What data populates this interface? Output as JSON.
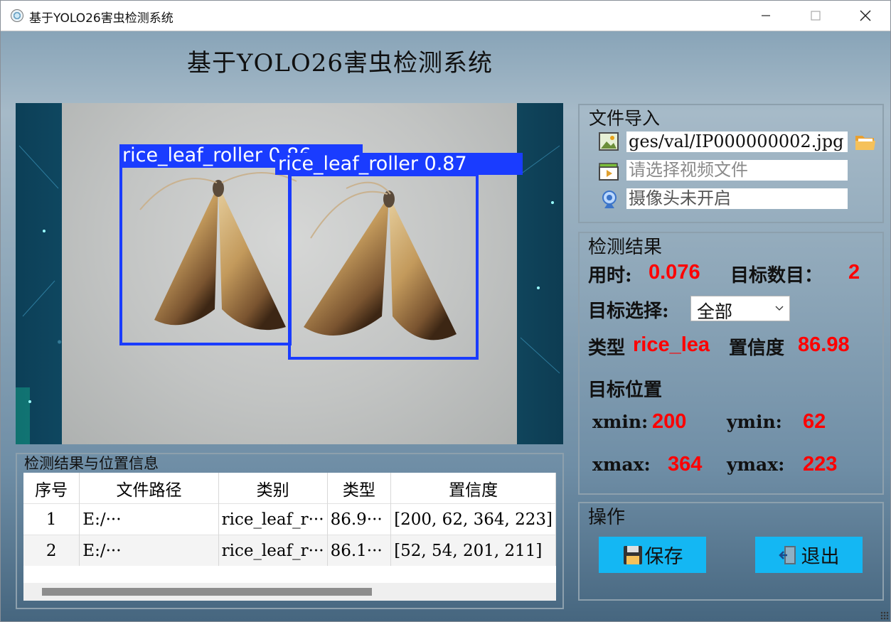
{
  "window": {
    "title": "基于YOLO26害虫检测系统"
  },
  "heading": "基于YOLO26害虫检测系统",
  "detections": [
    {
      "label": "rice_leaf_roller 0.86"
    },
    {
      "label": "rice_leaf_roller 0.87"
    }
  ],
  "file_import": {
    "title": "文件导入",
    "image_path": "ges/val/IP000000002.jpg",
    "video_placeholder": "请选择视频文件",
    "camera_status": "摄像头未开启"
  },
  "results": {
    "title": "检测结果",
    "time_label": "用时:",
    "time_value": "0.076",
    "count_label": "目标数目：",
    "count_value": "2",
    "select_label": "目标选择:",
    "select_value": "全部",
    "type_label": "类型",
    "type_value": "rice_lea",
    "conf_label": "置信度",
    "conf_value": "86.98",
    "pos_label": "目标位置",
    "xmin_label": "xmin:",
    "xmin_value": "200",
    "ymin_label": "ymin:",
    "ymin_value": "62",
    "xmax_label": "xmax:",
    "xmax_value": "364",
    "ymax_label": "ymax:",
    "ymax_value": "223"
  },
  "table": {
    "title": "检测结果与位置信息",
    "headers": [
      "序号",
      "文件路径",
      "类别",
      "类型",
      "置信度"
    ],
    "rows": [
      [
        "1",
        "E:/···",
        "rice_leaf_r···",
        "86.9···",
        "[200, 62, 364, 223]"
      ],
      [
        "2",
        "E:/···",
        "rice_leaf_r···",
        "86.1···",
        "[52, 54, 201, 211]"
      ]
    ]
  },
  "operations": {
    "title": "操作",
    "save_label": "保存",
    "exit_label": "退出"
  },
  "colors": {
    "accent_button": "#14b7f3",
    "result_value": "#ff0000",
    "bbox": "#1a3cff"
  }
}
